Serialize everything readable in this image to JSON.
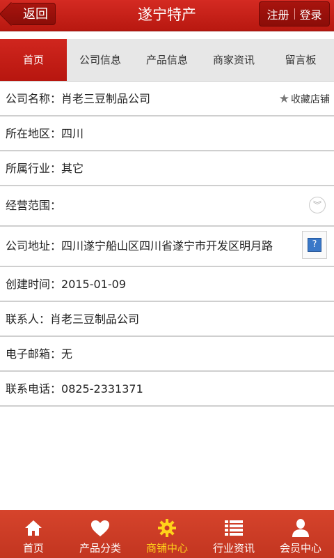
{
  "header": {
    "back_label": "返回",
    "title": "遂宁特产",
    "register_label": "注册",
    "login_label": "登录"
  },
  "tabs": [
    {
      "label": "首页"
    },
    {
      "label": "公司信息"
    },
    {
      "label": "产品信息"
    },
    {
      "label": "商家资讯"
    },
    {
      "label": "留言板"
    }
  ],
  "favorite_label": "收藏店铺",
  "info": [
    {
      "label": "公司名称：",
      "value": "肖老三豆制品公司"
    },
    {
      "label": "所在地区：",
      "value": "四川"
    },
    {
      "label": "所属行业：",
      "value": "其它"
    },
    {
      "label": "经营范围：",
      "value": ""
    },
    {
      "label": "公司地址：",
      "value": "四川遂宁船山区四川省遂宁市开发区明月路"
    },
    {
      "label": "创建时间：",
      "value": "2015-01-09"
    },
    {
      "label": "联系人：",
      "value": "肖老三豆制品公司"
    },
    {
      "label": "电子邮箱：",
      "value": "无"
    },
    {
      "label": "联系电话：",
      "value": "0825-2331371"
    }
  ],
  "bottom_nav": [
    {
      "label": "首页",
      "icon": "home-icon"
    },
    {
      "label": "产品分类",
      "icon": "heart-icon"
    },
    {
      "label": "商铺中心",
      "icon": "gear-icon"
    },
    {
      "label": "行业资讯",
      "icon": "list-icon"
    },
    {
      "label": "会员中心",
      "icon": "user-icon"
    }
  ],
  "colors": {
    "brand_red": "#c81e16",
    "active_nav": "#ffd21a"
  }
}
